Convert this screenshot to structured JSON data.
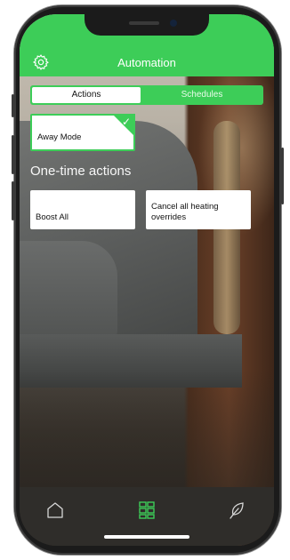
{
  "app": {
    "header_title": "Automation",
    "accent_color": "#3dcd58"
  },
  "tabs": [
    {
      "label": "Actions",
      "active": true
    },
    {
      "label": "Schedules",
      "active": false
    }
  ],
  "actions": {
    "away_mode": {
      "label": "Away Mode",
      "selected": true
    }
  },
  "one_time": {
    "section_title": "One-time actions",
    "items": [
      {
        "label": "Boost All"
      },
      {
        "label": "Cancel all heating overrides"
      }
    ]
  },
  "bottom_nav": [
    {
      "icon": "home-icon"
    },
    {
      "icon": "grid-icon",
      "active": true
    },
    {
      "icon": "leaf-icon"
    }
  ],
  "icons": {
    "settings": "gear-icon",
    "check": "checkmark-icon"
  }
}
